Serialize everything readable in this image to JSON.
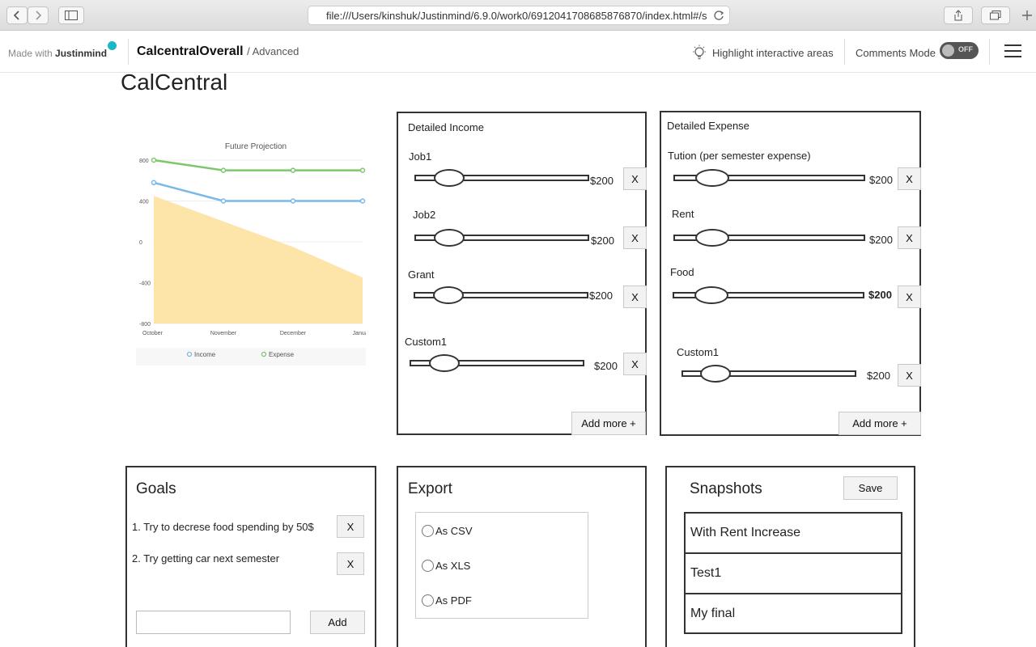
{
  "browser": {
    "url": "file:///Users/kinshuk/Justinmind/6.9.0/work0/6912041708685876870/index.html#/s"
  },
  "jm_header": {
    "made_with": "Made with",
    "brand": "Justinmind",
    "project_name": "CalcentralOverall",
    "project_sub": "/ Advanced",
    "highlight_label": "Highlight interactive areas",
    "comments_label": "Comments Mode",
    "toggle_state": "OFF"
  },
  "page": {
    "title": "CalCentral"
  },
  "chart_data": {
    "type": "line",
    "title": "Future Projection",
    "categories": [
      "October",
      "November",
      "December",
      "January"
    ],
    "yticks": [
      "800",
      "400",
      "0",
      "-400",
      "-800"
    ],
    "ylim": [
      -800,
      800
    ],
    "series": [
      {
        "name": "Income",
        "values": [
          580,
          400,
          400,
          400
        ],
        "color": "#7ab8e8"
      },
      {
        "name": "Expense",
        "values": [
          800,
          700,
          700,
          700
        ],
        "color": "#7cc86a"
      }
    ],
    "area": {
      "values": [
        450,
        200,
        -50,
        -350
      ],
      "baseline": -800,
      "color": "#fde09a"
    },
    "legend_position": "bottom"
  },
  "income": {
    "title": "Detailed Income",
    "rows": [
      {
        "label": "Job1",
        "amount": "$200",
        "remove": "X"
      },
      {
        "label": "Job2",
        "amount": "$200",
        "remove": "X"
      },
      {
        "label": "Grant",
        "amount": "$200",
        "remove": "X"
      },
      {
        "label": "Custom1",
        "amount": "$200",
        "remove": "X"
      }
    ],
    "add_more": "Add more +"
  },
  "expense": {
    "title": "Detailed Expense",
    "rows": [
      {
        "label": "Tution (per semester expense)",
        "amount": "$200",
        "remove": "X"
      },
      {
        "label": "Rent",
        "amount": "$200",
        "remove": "X"
      },
      {
        "label": "Food",
        "amount": "$200",
        "remove": "X"
      },
      {
        "label": "Custom1",
        "amount": "$200",
        "remove": "X"
      }
    ],
    "add_more": "Add more +"
  },
  "goals": {
    "title": "Goals",
    "items": [
      {
        "text": "1. Try to decrese food spending by 50$",
        "remove": "X"
      },
      {
        "text": "2. Try getting car next semester",
        "remove": "X"
      }
    ],
    "input_value": "",
    "add_label": "Add"
  },
  "export": {
    "title": "Export",
    "options": [
      "As CSV",
      "As XLS",
      "As PDF"
    ]
  },
  "snapshots": {
    "title": "Snapshots",
    "save_label": "Save",
    "items": [
      "With Rent Increase",
      "Test1",
      "My final"
    ]
  }
}
